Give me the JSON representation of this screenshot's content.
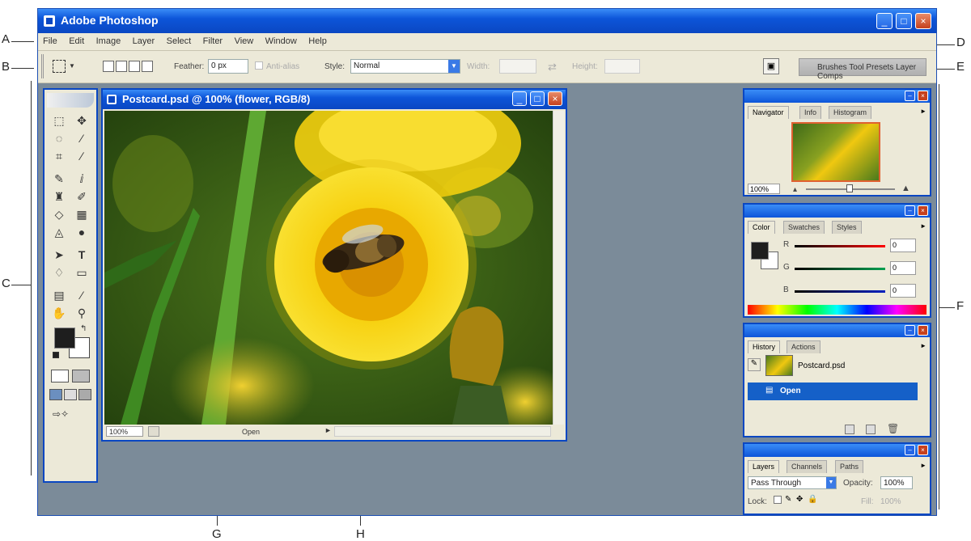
{
  "callouts": {
    "a": "A",
    "b": "B",
    "c": "C",
    "d": "D",
    "e": "E",
    "f": "F",
    "g": "G",
    "h": "H"
  },
  "app": {
    "title": "Adobe Photoshop",
    "menu": [
      "File",
      "Edit",
      "Image",
      "Layer",
      "Select",
      "Filter",
      "View",
      "Window",
      "Help"
    ],
    "options": {
      "feather_label": "Feather:",
      "feather_value": "0 px",
      "antialias_label": "Anti-alias",
      "style_label": "Style:",
      "style_value": "Normal",
      "width_label": "Width:",
      "height_label": "Height:"
    },
    "palette_well": "Brushes  Tool Presets  Layer Comps"
  },
  "document": {
    "title": "Postcard.psd @ 100% (flower, RGB/8)",
    "zoom": "100%",
    "status": "Open"
  },
  "navigator": {
    "tabs": [
      "Navigator",
      "Info",
      "Histogram"
    ],
    "zoom": "100%"
  },
  "color": {
    "tabs": [
      "Color",
      "Swatches",
      "Styles"
    ],
    "r_label": "R",
    "g_label": "G",
    "b_label": "B",
    "r_value": "0",
    "g_value": "0",
    "b_value": "0"
  },
  "history": {
    "tabs": [
      "History",
      "Actions"
    ],
    "snapshot": "Postcard.psd",
    "step": "Open"
  },
  "layers": {
    "tabs": [
      "Layers",
      "Channels",
      "Paths"
    ],
    "blend_mode": "Pass Through",
    "opacity_label": "Opacity:",
    "opacity_value": "100%",
    "lock_label": "Lock:",
    "fill_label": "Fill:",
    "fill_value": "100%"
  },
  "colors": {
    "titlebar": "#0a47c2",
    "workspace": "#7b8b99",
    "panel": "#ece9d8",
    "selection": "#1560c8"
  }
}
